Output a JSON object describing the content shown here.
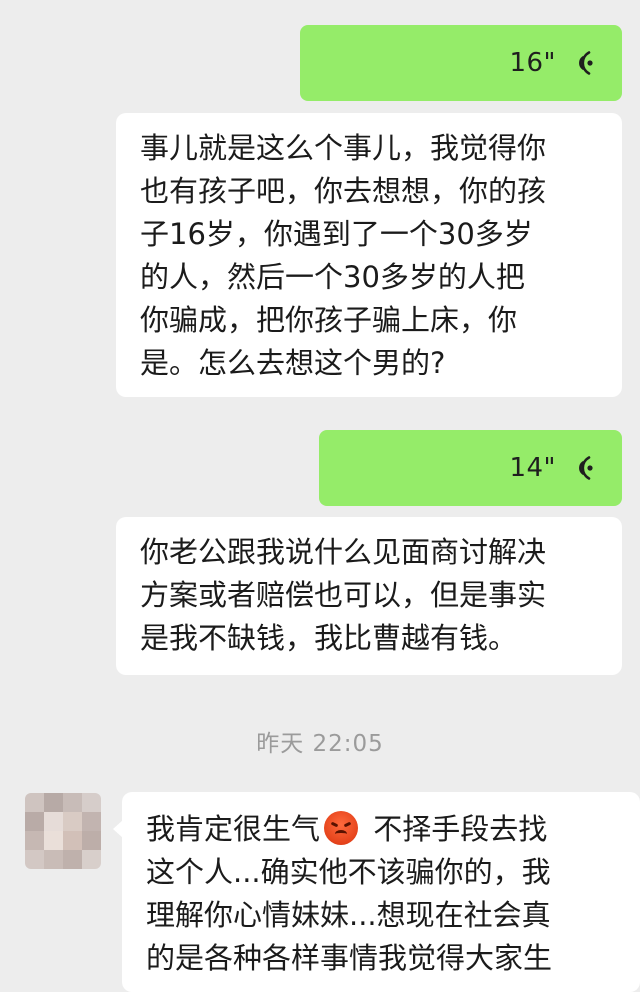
{
  "colors": {
    "background": "#ededed",
    "outgoing_bubble": "#95ec69",
    "incoming_bubble": "#ffffff",
    "timestamp_text": "#9b9b9b"
  },
  "messages": [
    {
      "voice_duration": "16\"",
      "transcript": "事儿就是这么个事儿，我觉得你\n也有孩子吧，你去想想，你的孩\n子16岁，你遇到了一个30多岁\n的人，然后一个30多岁的人把\n你骗成，把你孩子骗上床，你\n是。怎么去想这个男的?"
    },
    {
      "voice_duration": "14\"",
      "transcript": "你老公跟我说什么见面商讨解决\n方案或者赔偿也可以，但是事实\n是我不缺钱，我比曹越有钱。"
    }
  ],
  "timestamp": "昨天 22:05",
  "incoming": {
    "avatar_icon": "blurred-avatar-icon",
    "emoji_icon": "angry-face-emoji-icon",
    "text_before_emoji": "我肯定很生气",
    "text_after_emoji": " 不择手段去找\n这个人...确实他不该骗你的，我\n理解你心情妹妹...想现在社会真\n的是各种各样事情我觉得大家生"
  }
}
